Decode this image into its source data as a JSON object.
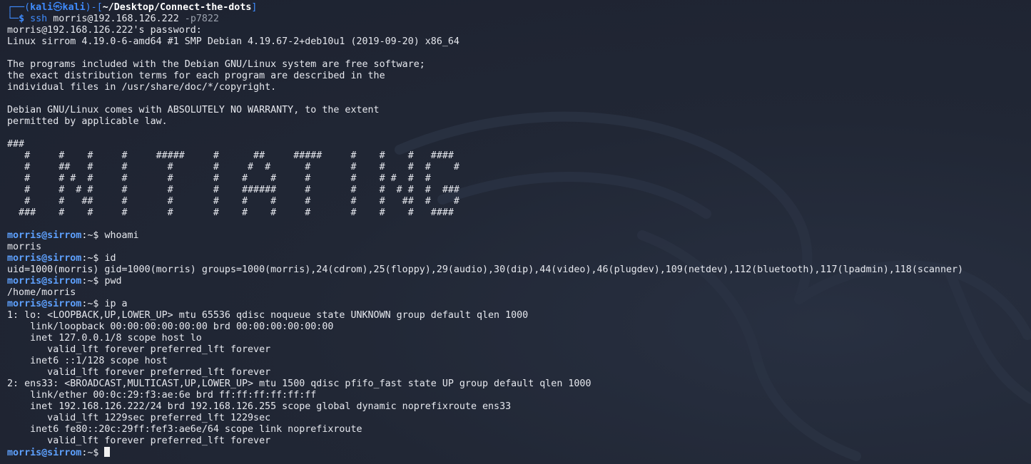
{
  "prompt_header": {
    "corner_top": "┌──(",
    "user": "kali",
    "at": "㉿",
    "host": "kali",
    "close_open": ")-[",
    "path": "~/Desktop/Connect-the-dots",
    "close": "]",
    "corner_bottom": "└─",
    "dollar": "$ ",
    "cmd": "ssh",
    "args": " morris@192.168.126.222 ",
    "opt": "-p7822"
  },
  "ssh_output": [
    "morris@192.168.126.222's password:",
    "Linux sirrom 4.19.0-6-amd64 #1 SMP Debian 4.19.67-2+deb10u1 (2019-09-20) x86_64",
    "",
    "The programs included with the Debian GNU/Linux system are free software;",
    "the exact distribution terms for each program are described in the",
    "individual files in /usr/share/doc/*/copyright.",
    "",
    "Debian GNU/Linux comes with ABSOLUTELY NO WARRANTY, to the extent",
    "permitted by applicable law.",
    "",
    "###",
    "   #     #    #     #     #####     #      ##     #####     #    #    #   ####",
    "   #     ##   #     #       #       #     #  #      #       #    #    #  #    #",
    "   #     # #  #     #       #       #    #    #     #       #    # #  #  #",
    "   #     #  # #     #       #       #    ######     #       #    #  # #  #  ###",
    "   #     #   ##     #       #       #    #    #     #       #    #   ##  #    #",
    "  ###    #    #     #       #       #    #    #     #       #    #    #   ####",
    ""
  ],
  "prompt": {
    "user_host": "morris@sirrom",
    "sep": ":~$ "
  },
  "session": [
    {
      "cmd": "whoami",
      "output": [
        "morris"
      ]
    },
    {
      "cmd": "id",
      "output": [
        "uid=1000(morris) gid=1000(morris) groups=1000(morris),24(cdrom),25(floppy),29(audio),30(dip),44(video),46(plugdev),109(netdev),112(bluetooth),117(lpadmin),118(scanner)"
      ]
    },
    {
      "cmd": "pwd",
      "output": [
        "/home/morris"
      ]
    },
    {
      "cmd": "ip a",
      "output": [
        "1: lo: <LOOPBACK,UP,LOWER_UP> mtu 65536 qdisc noqueue state UNKNOWN group default qlen 1000",
        "    link/loopback 00:00:00:00:00:00 brd 00:00:00:00:00:00",
        "    inet 127.0.0.1/8 scope host lo",
        "       valid_lft forever preferred_lft forever",
        "    inet6 ::1/128 scope host",
        "       valid_lft forever preferred_lft forever",
        "2: ens33: <BROADCAST,MULTICAST,UP,LOWER_UP> mtu 1500 qdisc pfifo_fast state UP group default qlen 1000",
        "    link/ether 00:0c:29:f3:ae:6e brd ff:ff:ff:ff:ff:ff",
        "    inet 192.168.126.222/24 brd 192.168.126.255 scope global dynamic noprefixroute ens33",
        "       valid_lft 1229sec preferred_lft 1229sec",
        "    inet6 fe80::20c:29ff:fef3:ae6e/64 scope link noprefixroute",
        "       valid_lft forever preferred_lft forever"
      ]
    }
  ],
  "colors": {
    "background": "#1f2430",
    "text": "#e6e8ee",
    "prompt_blue": "#5ea1ff",
    "kali_blue": "#3f8cff",
    "option_gray": "#9aa1ad"
  }
}
